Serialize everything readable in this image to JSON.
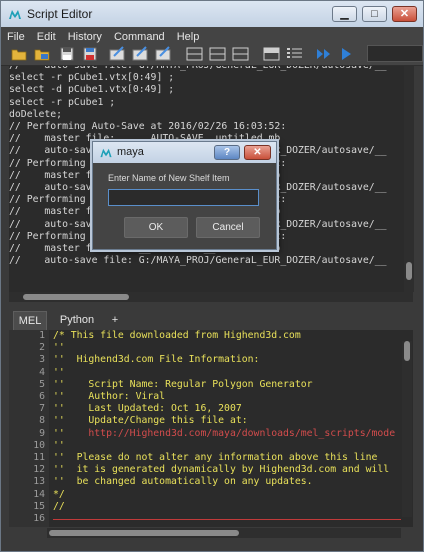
{
  "window": {
    "title": "Script Editor",
    "buttons": {
      "minimize": "▁",
      "maximize": "□",
      "close": "✕"
    }
  },
  "menu": [
    "File",
    "Edit",
    "History",
    "Command",
    "Help"
  ],
  "toolbar_icons": [
    "open-script-icon",
    "source-script-icon",
    "save-script-icon",
    "save-to-shelf-icon",
    "echo-all-commands-icon",
    "show-line-numbers-icon",
    "show-stack-trace-icon",
    "clear-history-icon",
    "clear-input-icon",
    "clear-all-icon",
    "show-history-only-icon",
    "show-input-only-icon",
    "show-both-icon",
    "search-icon",
    "list-icon",
    "execute-all-icon",
    "execute-icon"
  ],
  "history_lines": [
    "//    auto-save file: G:/MAYA_PROJ/GeneraL_EUR_DOZER/autosave/__",
    "select -r pCube1.vtx[0:49] ;",
    "select -d pCube1.vtx[0:49] ;",
    "select -r pCube1 ;",
    "doDelete;",
    "// Performing Auto-Save at 2016/02/26 16:03:52:",
    "//    master file:    __AUTO-SAVE__untitled.mb",
    "//    auto-save file: G:/MAYA_PROJ/GeneraL_EUR_DOZER/autosave/__",
    "// Performing Auto-Save at 2016/02/26 16:03:52:",
    "//    master file:    __AUTO-SAVE__untitled.mb",
    "//    auto-save file: G:/MAYA_PROJ/GeneraL_EUR_DOZER/autosave/__",
    "// Performing Auto-Save at 2016/02/26 16:03:52:",
    "//    master file:    __AUTO-SAVE__untitled.mb",
    "//    auto-save file: G:/MAYA_PROJ/GeneraL_EUR_DOZER/autosave/__",
    "// Performing Auto-Save at 2016/02/26 16:03:52:",
    "//    master file:    __AUTO-SAVE__untitled.mb",
    "//    auto-save file: G:/MAYA_PROJ/GeneraL_EUR_DOZER/autosave/__"
  ],
  "tabs": {
    "mel": "MEL",
    "python": "Python",
    "add": "+"
  },
  "line_numbers": [
    "1",
    "2",
    "3",
    "4",
    "5",
    "6",
    "7",
    "8",
    "9",
    "10",
    "11",
    "12",
    "13",
    "14",
    "15",
    "16"
  ],
  "code_lines": [
    "/* This file downloaded from Highend3d.com",
    "''",
    "''  Highend3d.com File Information:",
    "''",
    "''    Script Name: Regular Polygon Generator",
    "''    Author: Viral",
    "''    Last Updated: Oct 16, 2007",
    "''    Update/Change this file at:",
    "''    http://Highend3d.com/maya/downloads/mel_scripts/mode",
    "''",
    "''  Please do not alter any information above this line",
    "''  it is generated dynamically by Highend3d.com and will",
    "''  be changed automatically on any updates.",
    "*/",
    "//"
  ],
  "code_url_prefix": "''    ",
  "code_url": "http://Highend3d.com/maya/downloads/mel_scripts/mode",
  "dialog": {
    "title": "maya",
    "help": "?",
    "close": "✕",
    "label": "Enter Name of New Shelf Item",
    "input_value": "",
    "ok": "OK",
    "cancel": "Cancel"
  },
  "colors": {
    "accent_blue": "#2f7fd6",
    "code_yellow": "#e8e05a",
    "url_red": "#d24c4c"
  }
}
